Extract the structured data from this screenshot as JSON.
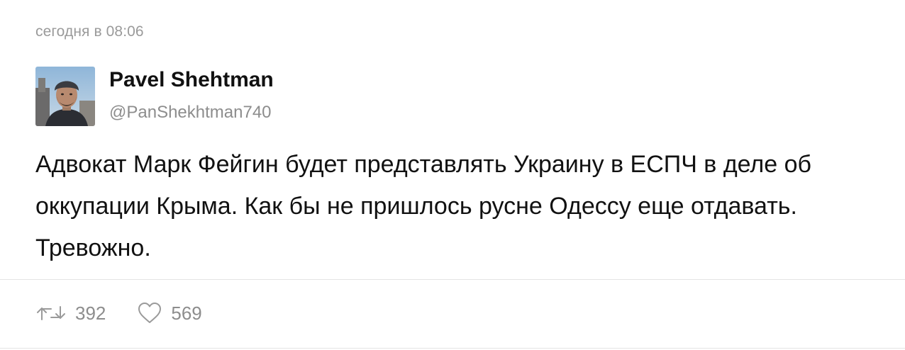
{
  "post": {
    "timestamp": "сегодня в 08:06",
    "author": {
      "display_name": "Pavel Shehtman",
      "handle": "@PanShekhtman740",
      "avatar_icon": "user-avatar-photo"
    },
    "text": "Адвокат Марк Фейгин будет представлять Украину в ЕСПЧ в деле об\nоккупации Крыма. Как бы не пришлось русне Одессу еще отдавать.\nТревожно.",
    "actions": {
      "retweets": {
        "icon": "retweet-icon",
        "count": "392"
      },
      "likes": {
        "icon": "heart-icon",
        "count": "569"
      }
    }
  },
  "colors": {
    "text": "#111111",
    "secondary_text": "#8d8d8d",
    "divider": "#e4e4e4",
    "background": "#ffffff"
  }
}
